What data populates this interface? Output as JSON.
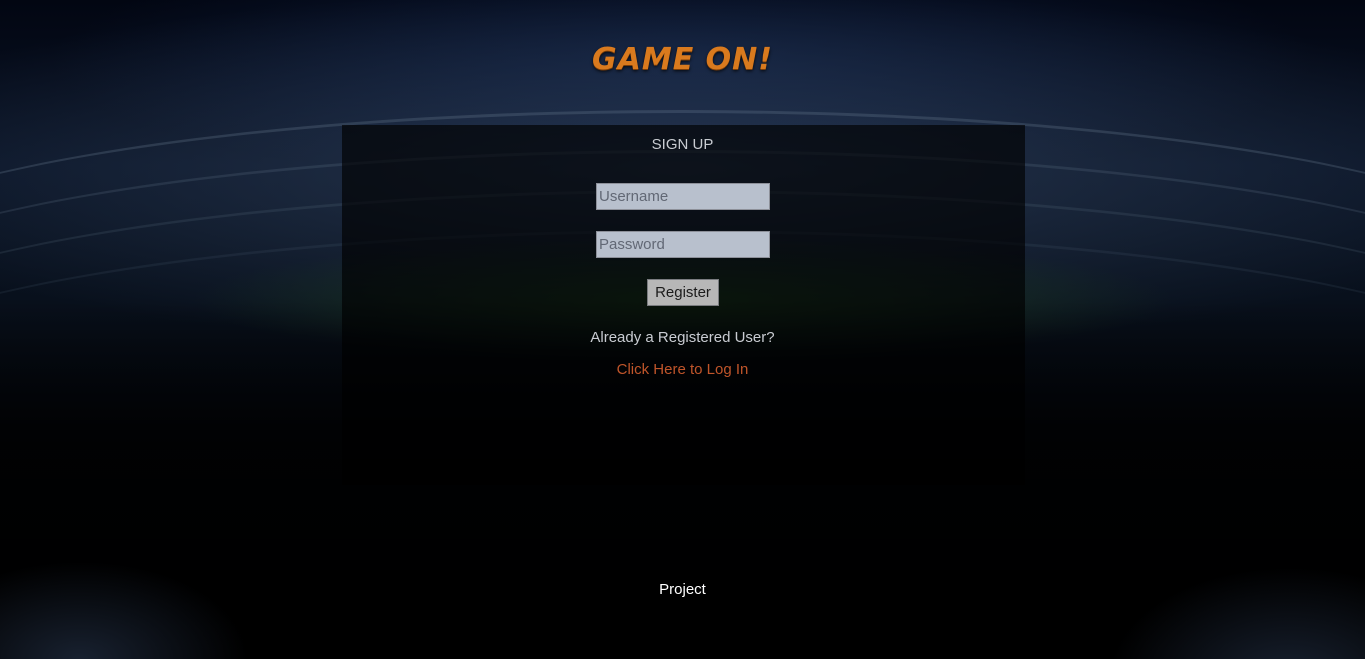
{
  "brand": {
    "logo_text": "GAME ON!"
  },
  "signup": {
    "title": "SIGN UP",
    "username_placeholder": "Username",
    "username_value": "",
    "password_placeholder": "Password",
    "password_value": "",
    "register_label": "Register",
    "already_text": "Already a Registered User?",
    "login_link_text": "Click Here to Log In"
  },
  "footer": {
    "text": "Project"
  },
  "colors": {
    "accent_orange": "#d97a1e",
    "link": "#c0552a",
    "panel_text": "#c9ccd2",
    "input_bg": "#b8c0cd"
  }
}
